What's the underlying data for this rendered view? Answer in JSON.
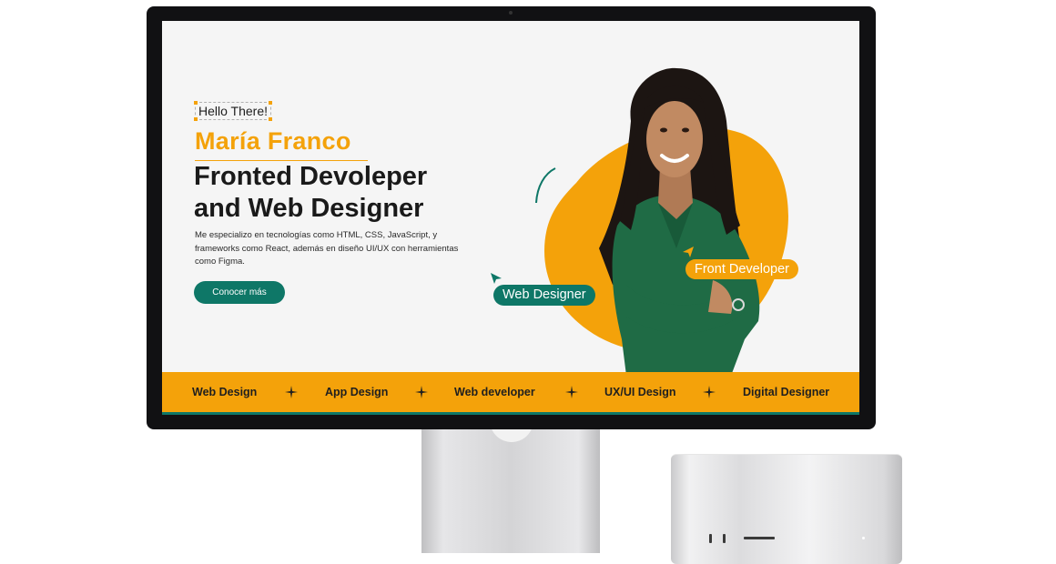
{
  "hero": {
    "greeting": "Hello There!",
    "name": "María Franco",
    "headline_line1": "Fronted Devoleper",
    "headline_line2": "and Web Designer",
    "description": "Me especializo en tecnologías como HTML, CSS, JavaScript, y frameworks como React, además en diseño UI/UX con herramientas como Figma.",
    "cta_label": "Conocer más"
  },
  "tags": {
    "web_designer": "Web Designer",
    "front_developer": "Front Developer"
  },
  "marquee": {
    "items": [
      "Web Design",
      "App Design",
      "Web developer",
      "UX/UI Design",
      "Digital Designer"
    ]
  },
  "colors": {
    "accent": "#f4a20a",
    "brand_teal": "#0e7767",
    "page_background": "#f5f5f5",
    "text_dark": "#1a1a1a"
  },
  "icons": {
    "separator": "sparkle-icon",
    "cursor": "cursor-arrow-icon"
  }
}
